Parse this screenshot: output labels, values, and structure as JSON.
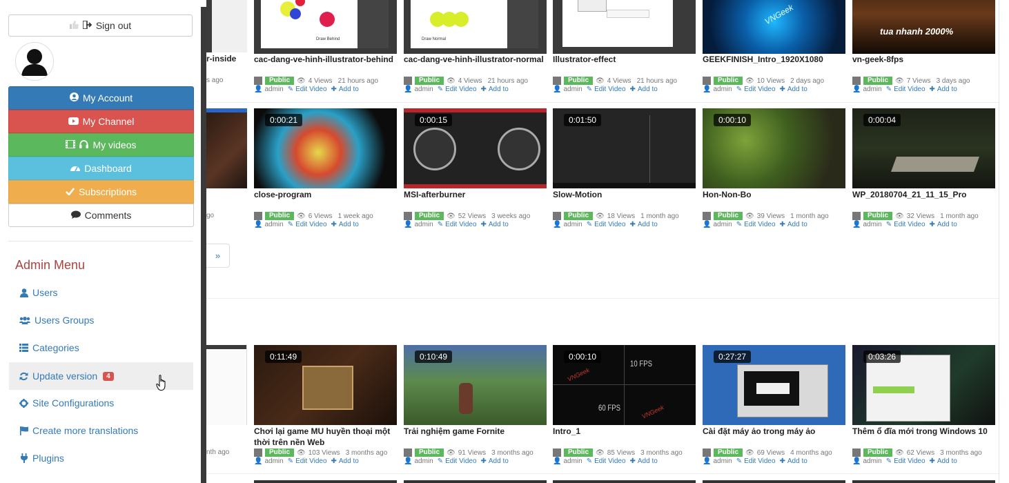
{
  "sidebar": {
    "sign_out": "Sign out",
    "buttons": {
      "my_account": "My Account",
      "my_channel": "My Channel",
      "my_videos": "My videos",
      "dashboard": "Dashboard",
      "subscriptions": "Subscriptions",
      "comments": "Comments"
    },
    "admin_menu_title": "Admin Menu",
    "admin_items": {
      "users": "Users",
      "users_groups": "Users Groups",
      "categories": "Categories",
      "update_version": "Update version",
      "update_count": "4",
      "site_configurations": "Site Configurations",
      "create_translations": "Create more translations",
      "plugins": "Plugins"
    }
  },
  "labels": {
    "public": "Public",
    "admin": "admin",
    "edit_video": "Edit Video",
    "add_to": "Add to",
    "views_suffix": "Views",
    "next_page": "»"
  },
  "partial": {
    "r1_title": "r-inside",
    "r1_time": "s ago",
    "r2_time": "go",
    "r3_time": "nth ago"
  },
  "videos": {
    "r1": [
      {
        "title": "cac-dang-ve-hinh-illustrator-behind",
        "views": "4 Views",
        "time": "21 hours ago"
      },
      {
        "title": "cac-dang-ve-hinh-illustrator-normal",
        "views": "4 Views",
        "time": "21 hours ago"
      },
      {
        "title": "Illustrator-effect",
        "views": "4 Views",
        "time": "21 hours ago"
      },
      {
        "title": "GEEKFINISH_Intro_1920X1080",
        "views": "10 Views",
        "time": "2 days ago"
      },
      {
        "title": "vn-geek-8fps",
        "views": "7 Views",
        "time": "3 days ago"
      }
    ],
    "r2": [
      {
        "title": "close-program",
        "duration": "0:00:21",
        "views": "6 Views",
        "time": "1 week ago"
      },
      {
        "title": "MSI-afterburner",
        "duration": "0:00:15",
        "views": "52 Views",
        "time": "3 weeks ago"
      },
      {
        "title": "Slow-Motion",
        "duration": "0:01:50",
        "views": "18 Views",
        "time": "1 month ago"
      },
      {
        "title": "Hon-Non-Bo",
        "duration": "0:00:10",
        "views": "39 Views",
        "time": "1 month ago"
      },
      {
        "title": "WP_20180704_21_11_15_Pro",
        "duration": "0:00:04",
        "views": "32 Views",
        "time": "1 month ago"
      }
    ],
    "r3": [
      {
        "title": "Chơi lại game MU huyền thoại một thời trên nền Web",
        "duration": "0:11:49",
        "views": "103 Views",
        "time": "3 months ago"
      },
      {
        "title": "Trải nghiệm game Fornite",
        "duration": "0:10:49",
        "views": "91 Views",
        "time": "3 months ago"
      },
      {
        "title": "Intro_1",
        "duration": "0:00:10",
        "views": "85 Views",
        "time": "3 months ago"
      },
      {
        "title": "Cài đặt máy ảo trong máy ảo",
        "duration": "0:27:27",
        "views": "69 Views",
        "time": "4 months ago"
      },
      {
        "title": "Thêm ổ đĩa mới trong Windows 10",
        "duration": "0:03:26",
        "views": "62 Views",
        "time": "3 months ago"
      }
    ]
  },
  "thumb_text": {
    "draw_behind": "Draw Behind",
    "draw_normal": "Draw Normal",
    "vngeek": "VNGeek",
    "tua_nhanh": "tua nhanh 2000%",
    "fps10": "10 FPS",
    "fps60": "60 FPS"
  }
}
